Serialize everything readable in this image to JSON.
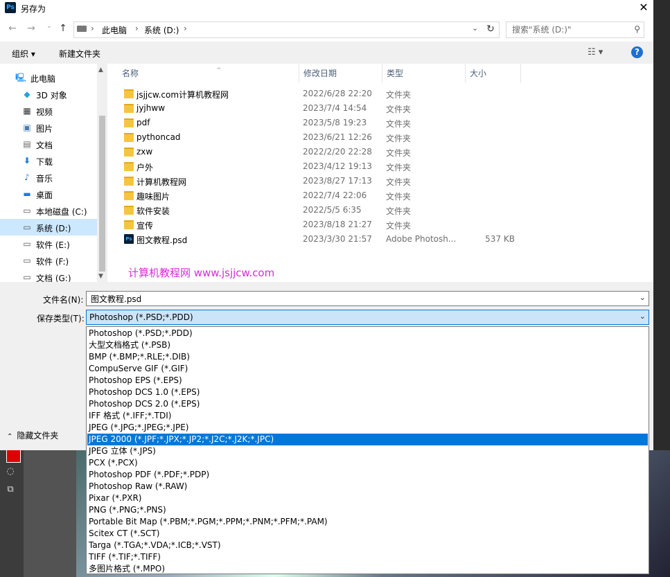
{
  "window": {
    "title": "另存为",
    "app_icon": "Ps"
  },
  "address": {
    "crumbs": [
      "此电脑",
      "系统 (D:)"
    ]
  },
  "search": {
    "placeholder": "搜索\"系统 (D:)\""
  },
  "toolbar": {
    "organize": "组织 ▾",
    "new_folder": "新建文件夹"
  },
  "nav_tree": [
    {
      "label": "此电脑",
      "icon": "computer-icon"
    },
    {
      "label": "3D 对象",
      "icon": "cube-icon"
    },
    {
      "label": "视频",
      "icon": "video-icon"
    },
    {
      "label": "图片",
      "icon": "picture-icon"
    },
    {
      "label": "文档",
      "icon": "document-icon"
    },
    {
      "label": "下载",
      "icon": "download-icon"
    },
    {
      "label": "音乐",
      "icon": "music-icon"
    },
    {
      "label": "桌面",
      "icon": "desktop-icon"
    },
    {
      "label": "本地磁盘 (C:)",
      "icon": "drive-icon"
    },
    {
      "label": "系统 (D:)",
      "icon": "drive-icon",
      "selected": true
    },
    {
      "label": "软件 (E:)",
      "icon": "drive-icon"
    },
    {
      "label": "软件 (F:)",
      "icon": "drive-icon"
    },
    {
      "label": "文档 (G:)",
      "icon": "drive-icon"
    }
  ],
  "columns": {
    "name": "名称",
    "modified": "修改日期",
    "type": "类型",
    "size": "大小"
  },
  "files": [
    {
      "name": "jsjjcw.com计算机教程网",
      "date": "2022/6/28 22:20",
      "type": "文件夹",
      "size": "",
      "kind": "folder"
    },
    {
      "name": "jyjhww",
      "date": "2023/7/4 14:54",
      "type": "文件夹",
      "size": "",
      "kind": "folder"
    },
    {
      "name": "pdf",
      "date": "2023/5/8 19:23",
      "type": "文件夹",
      "size": "",
      "kind": "folder"
    },
    {
      "name": "pythoncad",
      "date": "2023/6/21 12:26",
      "type": "文件夹",
      "size": "",
      "kind": "folder"
    },
    {
      "name": "zxw",
      "date": "2022/2/20 22:28",
      "type": "文件夹",
      "size": "",
      "kind": "folder"
    },
    {
      "name": "户外",
      "date": "2023/4/12 19:13",
      "type": "文件夹",
      "size": "",
      "kind": "folder"
    },
    {
      "name": "计算机教程网",
      "date": "2023/8/27 17:13",
      "type": "文件夹",
      "size": "",
      "kind": "folder"
    },
    {
      "name": "趣味图片",
      "date": "2022/7/4 22:06",
      "type": "文件夹",
      "size": "",
      "kind": "folder"
    },
    {
      "name": "软件安装",
      "date": "2022/5/5 6:35",
      "type": "文件夹",
      "size": "",
      "kind": "folder"
    },
    {
      "name": "宣传",
      "date": "2023/8/18 21:27",
      "type": "文件夹",
      "size": "",
      "kind": "folder"
    },
    {
      "name": "图文教程.psd",
      "date": "2023/3/30 21:57",
      "type": "Adobe Photosh...",
      "size": "537 KB",
      "kind": "psd"
    }
  ],
  "watermark": "计算机教程网 www.jsjjcw.com",
  "form": {
    "filename_label": "文件名(N):",
    "filename_value": "图文教程.psd",
    "filetype_label": "保存类型(T):",
    "filetype_value": "Photoshop (*.PSD;*.PDD)"
  },
  "hide_folders": "隐藏文件夹",
  "filetype_options": [
    "Photoshop (*.PSD;*.PDD)",
    "大型文档格式 (*.PSB)",
    "BMP (*.BMP;*.RLE;*.DIB)",
    "CompuServe GIF (*.GIF)",
    "Photoshop EPS (*.EPS)",
    "Photoshop DCS 1.0 (*.EPS)",
    "Photoshop DCS 2.0 (*.EPS)",
    "IFF 格式 (*.IFF;*.TDI)",
    "JPEG (*.JPG;*.JPEG;*.JPE)",
    "JPEG 2000 (*.JPF;*.JPX;*.JP2;*.J2C;*.J2K;*.JPC)",
    "JPEG 立体 (*.JPS)",
    "PCX (*.PCX)",
    "Photoshop PDF (*.PDF;*.PDP)",
    "Photoshop Raw (*.RAW)",
    "Pixar (*.PXR)",
    "PNG (*.PNG;*.PNS)",
    "Portable Bit Map (*.PBM;*.PGM;*.PPM;*.PNM;*.PFM;*.PAM)",
    "Scitex CT (*.SCT)",
    "Targa (*.TGA;*.VDA;*.ICB;*.VST)",
    "TIFF (*.TIF;*.TIFF)",
    "多图片格式 (*.MPO)"
  ],
  "filetype_selected_index": 9,
  "colors": {
    "accent": "#0078d7",
    "selection": "#cce8ff",
    "watermark": "#d62bd6",
    "swatch": "#e00000"
  }
}
